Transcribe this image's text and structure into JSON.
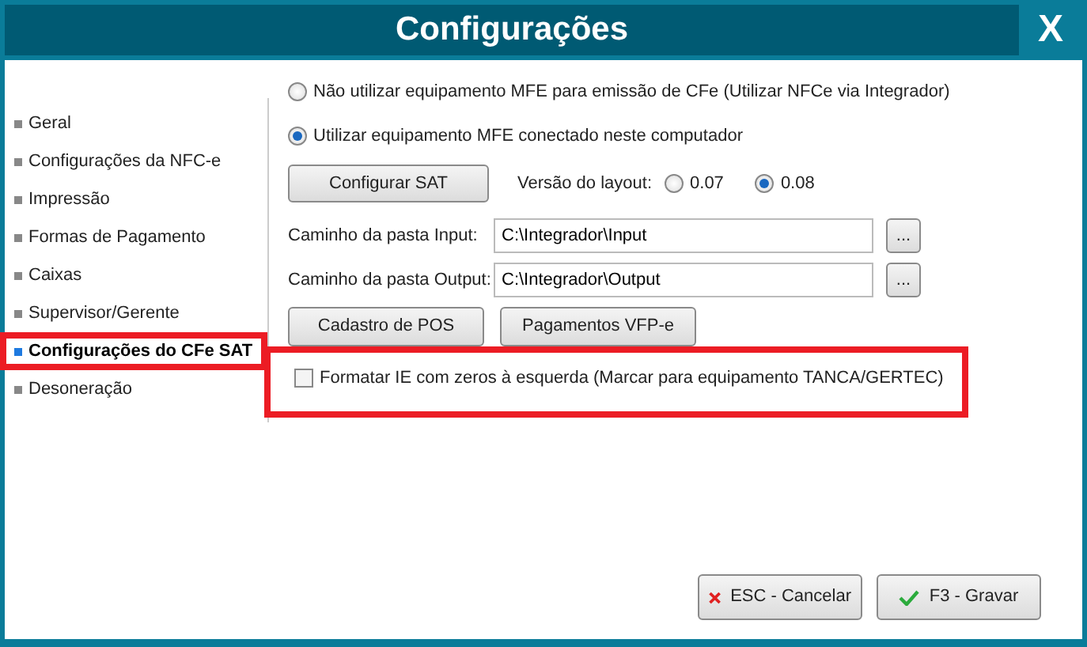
{
  "window": {
    "title": "Configurações",
    "close": "X"
  },
  "sidebar": {
    "items": [
      {
        "label": "Geral",
        "selected": false,
        "highlighted": false
      },
      {
        "label": "Configurações da NFC-e",
        "selected": false,
        "highlighted": false
      },
      {
        "label": "Impressão",
        "selected": false,
        "highlighted": false
      },
      {
        "label": "Formas de Pagamento",
        "selected": false,
        "highlighted": false
      },
      {
        "label": "Caixas",
        "selected": false,
        "highlighted": false
      },
      {
        "label": "Supervisor/Gerente",
        "selected": false,
        "highlighted": false
      },
      {
        "label": "Configurações do CFe SAT",
        "selected": true,
        "highlighted": true
      },
      {
        "label": "Desoneração",
        "selected": false,
        "highlighted": false
      }
    ]
  },
  "mode_options": [
    {
      "label": "Não utilizar equipamento MFE para emissão de CFe (Utilizar NFCe via Integrador)",
      "selected": false
    },
    {
      "label": "Utilizar equipamento MFE conectado neste computador",
      "selected": true
    }
  ],
  "configure_button": "Configurar SAT",
  "layout_version": {
    "label": "Versão do layout:",
    "options": [
      {
        "label": "0.07",
        "selected": false
      },
      {
        "label": "0.08",
        "selected": true
      }
    ]
  },
  "paths": [
    {
      "label": "Caminho da pasta Input:",
      "value": "C:\\Integrador\\Input",
      "browse": "..."
    },
    {
      "label": "Caminho da pasta Output:",
      "value": "C:\\Integrador\\Output",
      "browse": "..."
    }
  ],
  "action_buttons": [
    "Cadastro de POS",
    "Pagamentos VFP-e"
  ],
  "format_ie": {
    "label": "Formatar IE com zeros à esquerda (Marcar para equipamento TANCA/GERTEC)",
    "checked": false,
    "highlighted": true
  },
  "footer_buttons": [
    {
      "label": "ESC - Cancelar",
      "kind": "cancel"
    },
    {
      "label": "F3 - Gravar",
      "kind": "save"
    }
  ]
}
